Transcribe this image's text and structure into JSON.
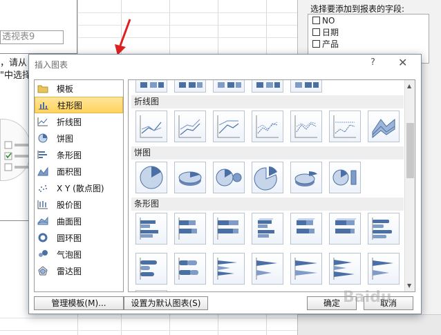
{
  "background": {
    "pivot_name": "透视表9",
    "text_line1": "，请从",
    "text_line2": "\"中选择"
  },
  "panel": {
    "title": "选择要添加到报表的字段:",
    "fields": [
      {
        "label": "NO"
      },
      {
        "label": "日期"
      },
      {
        "label": "产品"
      }
    ]
  },
  "dialog": {
    "title": "插入图表",
    "help": "?",
    "close": "✕",
    "categories": [
      {
        "label": "模板",
        "icon": "folder-icon"
      },
      {
        "label": "柱形图",
        "icon": "column-chart-icon",
        "selected": true
      },
      {
        "label": "折线图",
        "icon": "line-chart-icon"
      },
      {
        "label": "饼图",
        "icon": "pie-chart-icon"
      },
      {
        "label": "条形图",
        "icon": "bar-chart-icon"
      },
      {
        "label": "面积图",
        "icon": "area-chart-icon"
      },
      {
        "label": "X Y (散点图)",
        "icon": "scatter-chart-icon"
      },
      {
        "label": "股价图",
        "icon": "stock-chart-icon"
      },
      {
        "label": "曲面图",
        "icon": "surface-chart-icon"
      },
      {
        "label": "圆环图",
        "icon": "doughnut-chart-icon"
      },
      {
        "label": "气泡图",
        "icon": "bubble-chart-icon"
      },
      {
        "label": "雷达图",
        "icon": "radar-chart-icon"
      }
    ],
    "sections": {
      "line": "折线图",
      "pie": "饼图",
      "bar": "条形图"
    },
    "manage_templates": "管理模板(M)...",
    "set_default": "设置为默认图表(S)",
    "ok": "确定",
    "cancel": "取消"
  },
  "watermark": "Baidu",
  "colors": {
    "accent_blue": "#4a6fa5",
    "selected_bg": "#ffd35c",
    "arrow_red": "#e02020"
  }
}
